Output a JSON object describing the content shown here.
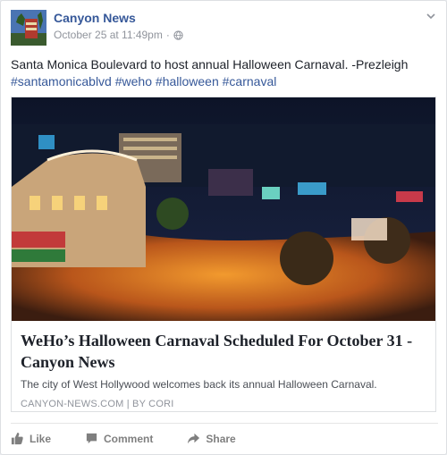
{
  "post": {
    "page_name": "Canyon News",
    "timestamp": "October 25 at 11:49pm",
    "separator": "·",
    "message": "Santa Monica Boulevard to host annual Halloween Carnaval. -Prezleigh",
    "hashtags": [
      "#santamonicablvd",
      "#weho",
      "#halloween",
      "#carnaval"
    ]
  },
  "link_card": {
    "title": "WeHo’s Halloween Carnaval Scheduled For October 31 - Canyon News",
    "description": "The city of West Hollywood welcomes back its annual Halloween Carnaval.",
    "source": "CANYON-NEWS.COM",
    "source_sep": "|",
    "byline": "BY CORI"
  },
  "actions": {
    "like": "Like",
    "comment": "Comment",
    "share": "Share"
  },
  "colors": {
    "link": "#365899",
    "meta": "#90949c",
    "action": "#7f7f7f"
  }
}
